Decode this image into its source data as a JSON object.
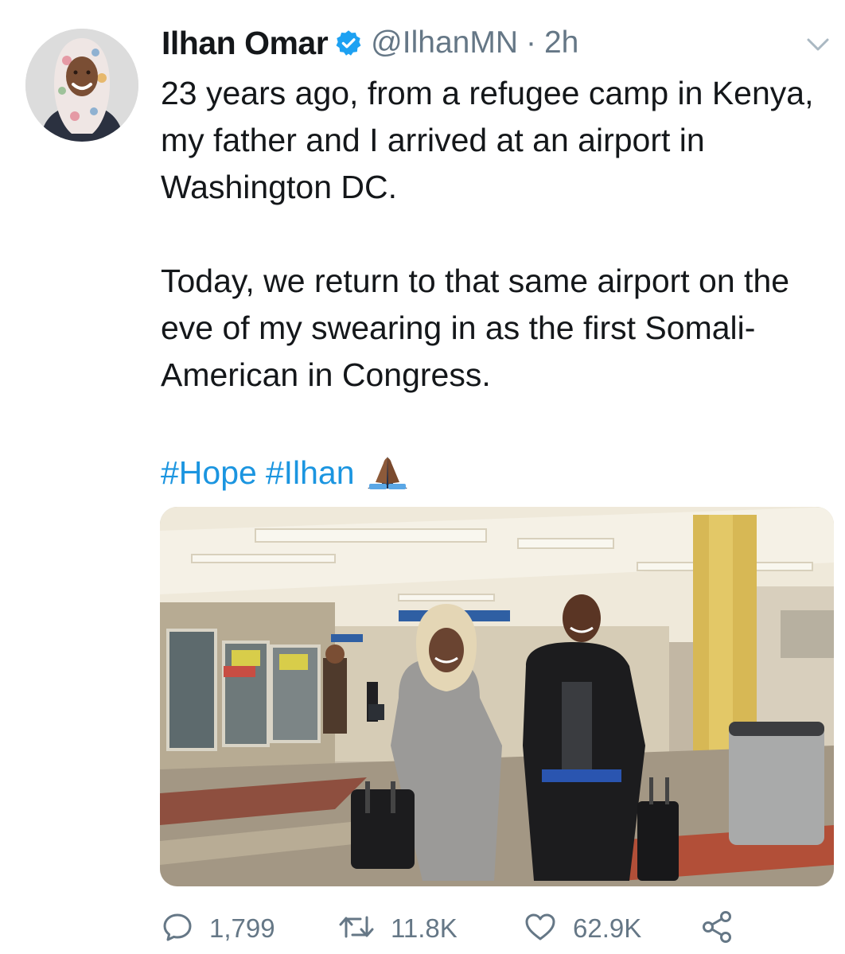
{
  "tweet": {
    "display_name": "Ilhan Omar",
    "handle": "@IlhanMN",
    "separator": "·",
    "time": "2h",
    "paragraph_1": "23 years ago, from a refugee camp in Kenya, my father and I arrived at an airport in Washington DC.",
    "paragraph_2": "Today, we return to that same airport on the eve of my swearing in as the first Somali-American in Congress.",
    "hashtags": [
      "#Hope",
      "#Ilhan"
    ],
    "emoji": "folded-hands",
    "verified": true
  },
  "actions": {
    "replies": "1,799",
    "retweets": "11.8K",
    "likes": "62.9K"
  },
  "colors": {
    "link": "#1b95e0",
    "secondary_text": "#657786",
    "primary_text": "#14171a",
    "verified_badge": "#1da1f2"
  },
  "icons": [
    "verified-badge-icon",
    "chevron-down-icon",
    "reply-icon",
    "retweet-icon",
    "like-icon",
    "share-icon"
  ]
}
